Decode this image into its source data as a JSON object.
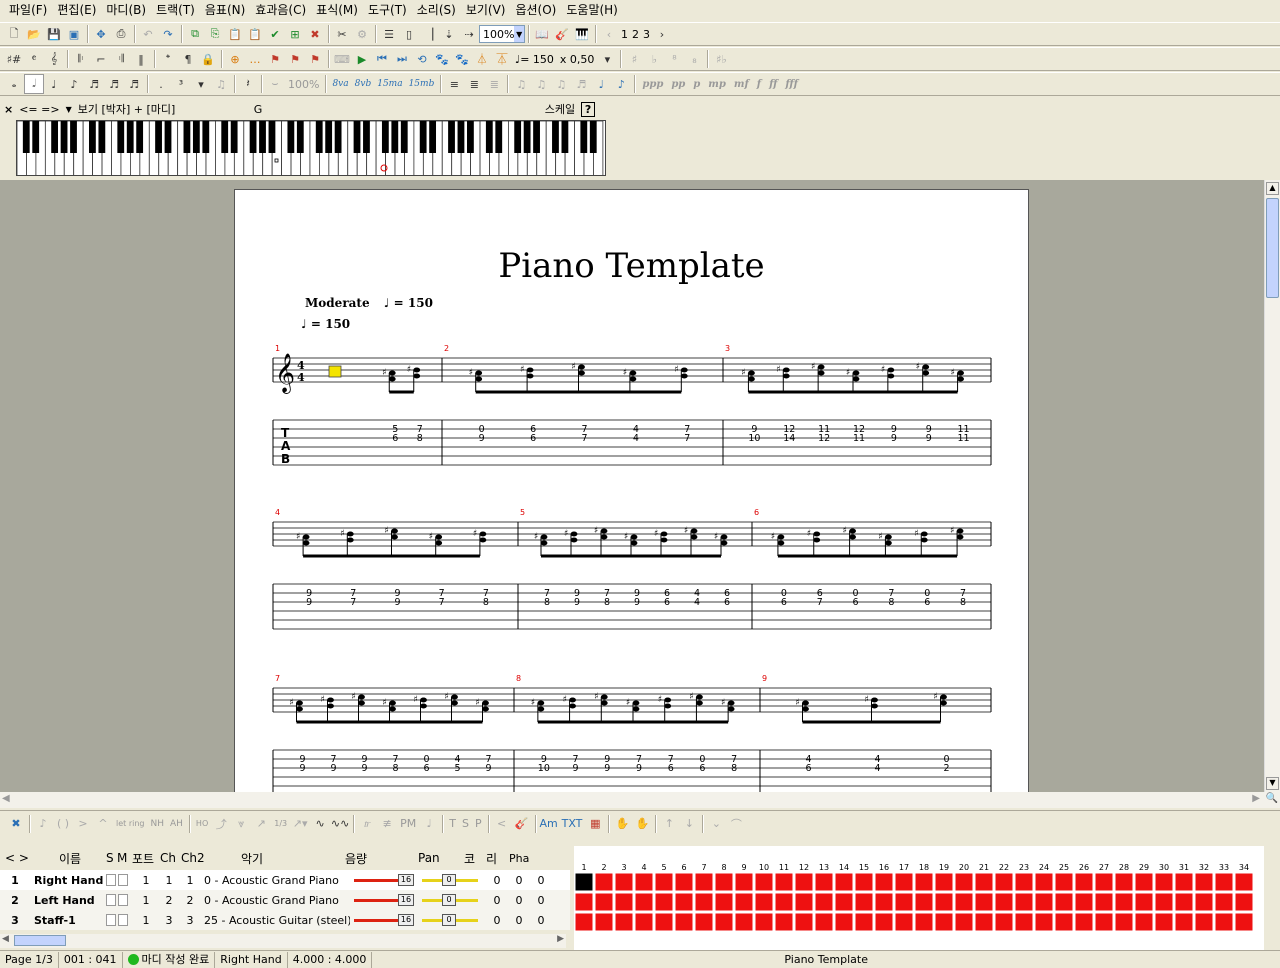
{
  "menu": [
    "파일(F)",
    "편집(E)",
    "마디(B)",
    "트랙(T)",
    "음표(N)",
    "효과음(C)",
    "표식(M)",
    "도구(T)",
    "소리(S)",
    "보기(V)",
    "옵션(O)",
    "도움말(H)"
  ],
  "toolbar": {
    "zoom": "100%",
    "pages": [
      "1",
      "2",
      "3"
    ],
    "tempo": "♩= 150",
    "speed": "x 0,50",
    "volume_pct": "100%",
    "octave_labels": [
      "8va",
      "8vb",
      "15ma",
      "15mb"
    ],
    "dynamics": [
      "ppp",
      "pp",
      "p",
      "mp",
      "mf",
      "f",
      "ff",
      "fff"
    ]
  },
  "piano": {
    "close": "×",
    "nav": "<= =>",
    "view_label": "보기 [박자] + [마디]",
    "key": "G",
    "scale_label": "스케일",
    "help": "?"
  },
  "score": {
    "title": "Piano Template",
    "tempo_text": "Moderate",
    "tempo1": "= 150",
    "tempo2": "= 150"
  },
  "systems": [
    {
      "measures": [
        {
          "num": "1",
          "tab": [
            [
              "5",
              "6"
            ],
            [
              "7",
              "8"
            ]
          ]
        },
        {
          "num": "2",
          "tab": [
            [
              "0",
              "9"
            ],
            [
              "6",
              "6"
            ],
            [
              "7",
              "7"
            ],
            [
              "4",
              "4"
            ],
            [
              "7",
              "7"
            ]
          ]
        },
        {
          "num": "3",
          "tab": [
            [
              "9",
              "10"
            ],
            [
              "12",
              "14"
            ],
            [
              "11",
              "12"
            ],
            [
              "12",
              "11"
            ],
            [
              "9",
              "9"
            ],
            [
              "9",
              "9"
            ],
            [
              "11",
              "11"
            ]
          ]
        }
      ]
    },
    {
      "measures": [
        {
          "num": "4",
          "tab": [
            [
              "9",
              "9"
            ],
            [
              "7",
              "7"
            ],
            [
              "9",
              "9"
            ],
            [
              "7",
              "7"
            ],
            [
              "7",
              "8"
            ]
          ]
        },
        {
          "num": "5",
          "tab": [
            [
              "7",
              "8"
            ],
            [
              "9",
              "9"
            ],
            [
              "7",
              "8"
            ],
            [
              "9",
              "9"
            ],
            [
              "6",
              "6"
            ],
            [
              "4",
              "4"
            ],
            [
              "6",
              "6"
            ]
          ]
        },
        {
          "num": "6",
          "tab": [
            [
              "0",
              "6"
            ],
            [
              "6",
              "7"
            ],
            [
              "0",
              "6"
            ],
            [
              "7",
              "8"
            ],
            [
              "0",
              "6"
            ],
            [
              "7",
              "8"
            ]
          ]
        }
      ]
    },
    {
      "measures": [
        {
          "num": "7",
          "tab": [
            [
              "9",
              "9"
            ],
            [
              "7",
              "9"
            ],
            [
              "9",
              "9"
            ],
            [
              "7",
              "8"
            ],
            [
              "0",
              "6"
            ],
            [
              "4",
              "5"
            ],
            [
              "7",
              "9"
            ]
          ]
        },
        {
          "num": "8",
          "tab": [
            [
              "9",
              "10"
            ],
            [
              "7",
              "9"
            ],
            [
              "9",
              "9"
            ],
            [
              "7",
              "9"
            ],
            [
              "7",
              "6"
            ],
            [
              "0",
              "6"
            ],
            [
              "7",
              "8"
            ]
          ]
        },
        {
          "num": "9",
          "tab": [
            [
              "4",
              "6"
            ],
            [
              "4",
              "4"
            ],
            [
              "0",
              "2"
            ]
          ]
        }
      ]
    }
  ],
  "fx_labels": [
    "let ring",
    "NH",
    "AH",
    "PM",
    "T",
    "S",
    "P",
    "TXT",
    "HO",
    "1/3"
  ],
  "tracks": {
    "headers": {
      "name": "이름",
      "s": "S",
      "m": "M",
      "port": "포트",
      "ch": "Ch",
      "ch2": "Ch2",
      "instrument": "악기",
      "volume": "음량",
      "pan": "Pan",
      "chorus": "코",
      "reverb": "리",
      "phaser": "Pha"
    },
    "rows": [
      {
        "num": "1",
        "name": "Right Hand",
        "port": "1",
        "ch": "1",
        "ch2": "1",
        "instrument": "0 - Acoustic Grand Piano",
        "vol": "16",
        "pan": "0",
        "c": "0",
        "r": "0",
        "p": "0"
      },
      {
        "num": "2",
        "name": "Left Hand",
        "port": "1",
        "ch": "2",
        "ch2": "2",
        "instrument": "0 - Acoustic Grand Piano",
        "vol": "16",
        "pan": "0",
        "c": "0",
        "r": "0",
        "p": "0"
      },
      {
        "num": "3",
        "name": "Staff-1",
        "port": "1",
        "ch": "3",
        "ch2": "3",
        "instrument": "25 - Acoustic Guitar (steel)",
        "vol": "16",
        "pan": "0",
        "c": "0",
        "r": "0",
        "p": "0"
      }
    ]
  },
  "measures_grid": {
    "numbers": [
      "1",
      "2",
      "3",
      "4",
      "5",
      "6",
      "7",
      "8",
      "9",
      "10",
      "11",
      "12",
      "13",
      "14",
      "15",
      "16",
      "17",
      "18",
      "19",
      "20",
      "21",
      "22",
      "23",
      "24",
      "25",
      "26",
      "27",
      "28",
      "29",
      "30",
      "31",
      "32",
      "33",
      "34"
    ],
    "fill_color": "#ee1111"
  },
  "status": {
    "page": "Page 1/3",
    "position": "001 : 041",
    "midi": "마디 작성 완료",
    "track": "Right Hand",
    "time_sig": "4.000 : 4.000",
    "song": "Piano Template"
  }
}
